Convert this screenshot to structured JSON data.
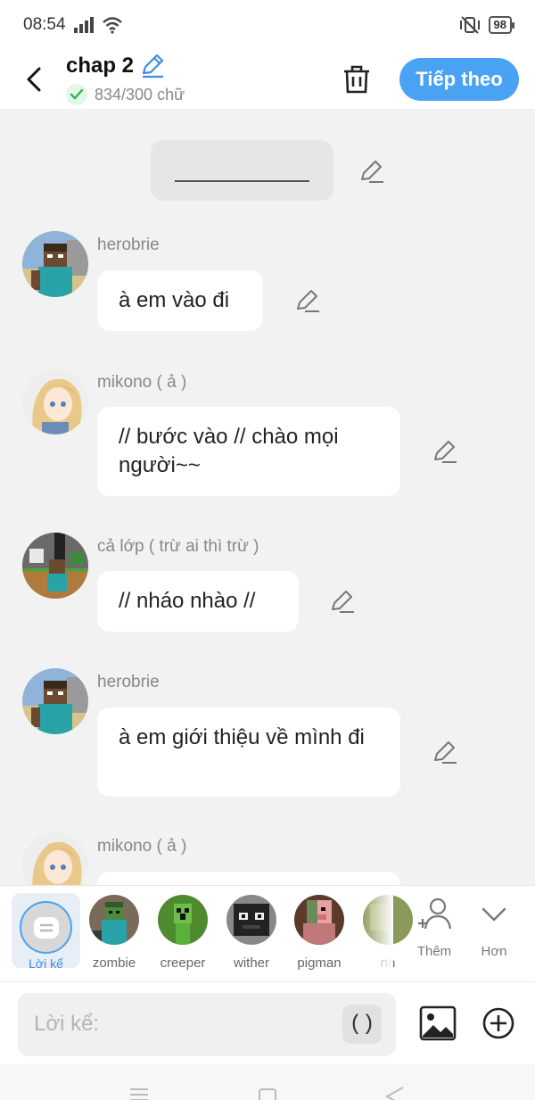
{
  "status_bar": {
    "time": "08:54",
    "battery": "98"
  },
  "header": {
    "title": "chap 2",
    "word_count": "834/300 chữ",
    "next_button": "Tiếp theo"
  },
  "messages": [
    {
      "name": "herobrie",
      "text": "à em vào đi"
    },
    {
      "name": "mikono ( ả )",
      "text": "//  bước vào // chào mọi người~~"
    },
    {
      "name": "cả lớp ( trừ ai thì trừ )",
      "text": "// nháo nhào //"
    },
    {
      "name": "herobrie",
      "text": "à em giới thiệu về mình đi"
    },
    {
      "name": "mikono ( ả )",
      "text": ""
    }
  ],
  "characters": {
    "narrator": "Lời kể",
    "items": [
      "zombie",
      "creeper",
      "wither",
      "pigman",
      "nh"
    ],
    "more": "Thêm",
    "expand": "Hơn"
  },
  "input": {
    "placeholder": "Lời kể:",
    "paren_button": "()"
  },
  "colors": {
    "accent": "#4aa3f2",
    "background": "#f2f2f2",
    "bubble": "#ffffff"
  }
}
